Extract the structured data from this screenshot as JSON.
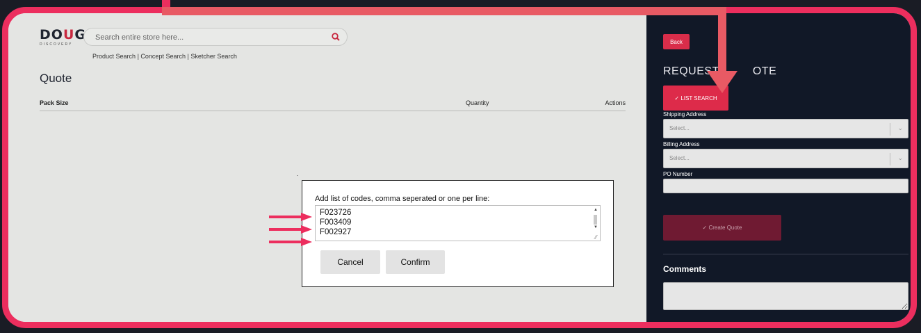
{
  "header": {
    "logo_main_start": "DO",
    "logo_main_o": "U",
    "logo_main_end": "G",
    "logo_sub": "DISCOVERY",
    "search_placeholder": "Search entire store here...",
    "search_links": [
      "Product Search",
      "Concept Search",
      "Sketcher Search"
    ],
    "search_link_separator": "|"
  },
  "main": {
    "title": "Quote",
    "table_columns": [
      "Pack Size",
      "Quantity",
      "Actions"
    ]
  },
  "modal": {
    "label": "Add list of codes, comma seperated or one per line:",
    "codes": [
      "F023726",
      "F003409",
      "F002927"
    ],
    "cancel_label": "Cancel",
    "confirm_label": "Confirm"
  },
  "sidebar": {
    "back_label": "Back",
    "title_start": "REQUEST",
    "title_end": "OTE",
    "list_search_label": "LIST SEARCH",
    "list_search_check": "✓",
    "shipping_label": "Shipping Address",
    "shipping_value": "Select...",
    "billing_label": "Billing Address",
    "billing_value": "Select...",
    "po_label": "PO Number",
    "create_quote_label": "Create Quote",
    "create_quote_check": "✓",
    "comments_label": "Comments"
  },
  "colors": {
    "annotation": "#ec2e5e",
    "accent": "#d92d4a",
    "sidebar_bg": "#111827",
    "content_bg": "#e4e5e3"
  },
  "icons": {
    "search": "search-icon",
    "chevron": "chevron-down-icon",
    "check": "check-icon",
    "annotation_arrow": "arrow-right-icon"
  }
}
